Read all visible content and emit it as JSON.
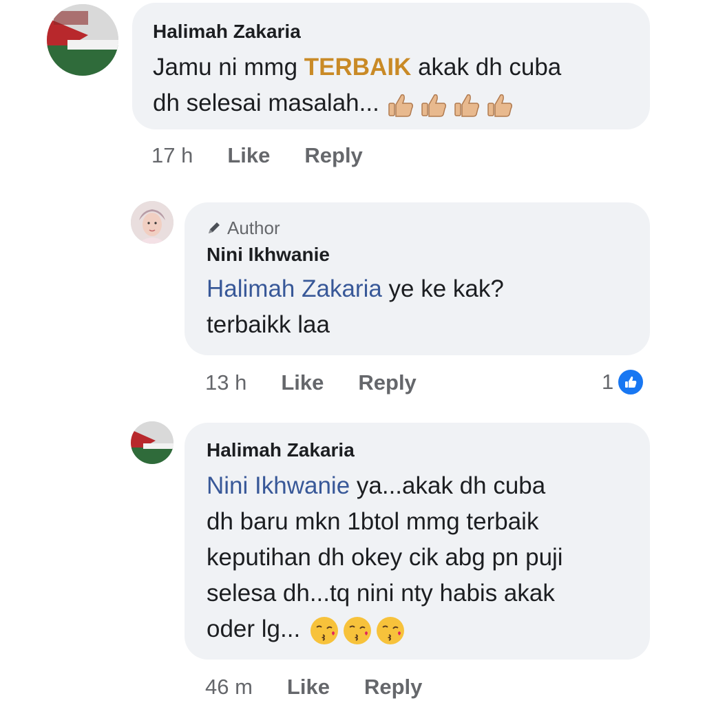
{
  "comments": [
    {
      "author": "Halimah Zakaria",
      "text_before": "Jamu ni mmg ",
      "highlight": "TERBAIK",
      "text_after": " akak dh cuba",
      "text_line2": "dh selesai masalah...",
      "emoji": "thumbs-up x4",
      "time": "17 h",
      "like_label": "Like",
      "reply_label": "Reply"
    },
    {
      "author_badge": "Author",
      "author": "Nini Ikhwanie",
      "mention": "Halimah Zakaria",
      "text_after": " ye ke kak?",
      "text_line2": "terbaikk laa",
      "time": "13 h",
      "like_label": "Like",
      "reply_label": "Reply",
      "reaction_count": "1"
    },
    {
      "author": "Halimah Zakaria",
      "mention": "Nini Ikhwanie",
      "text_after": " ya...akak dh cuba",
      "lines": [
        "dh baru mkn 1btol mmg terbaik",
        "keputihan dh okey cik abg pn puji",
        "selesa dh...tq nini nty habis akak"
      ],
      "last_line": "oder lg...",
      "emoji": "kissing-heart x3",
      "time": "46 m",
      "like_label": "Like",
      "reply_label": "Reply"
    }
  ],
  "colors": {
    "bubble": "#f0f2f5",
    "mention": "#385898",
    "highlight": "#c98a26",
    "like_blue": "#1877f2",
    "meta": "#65676b"
  }
}
